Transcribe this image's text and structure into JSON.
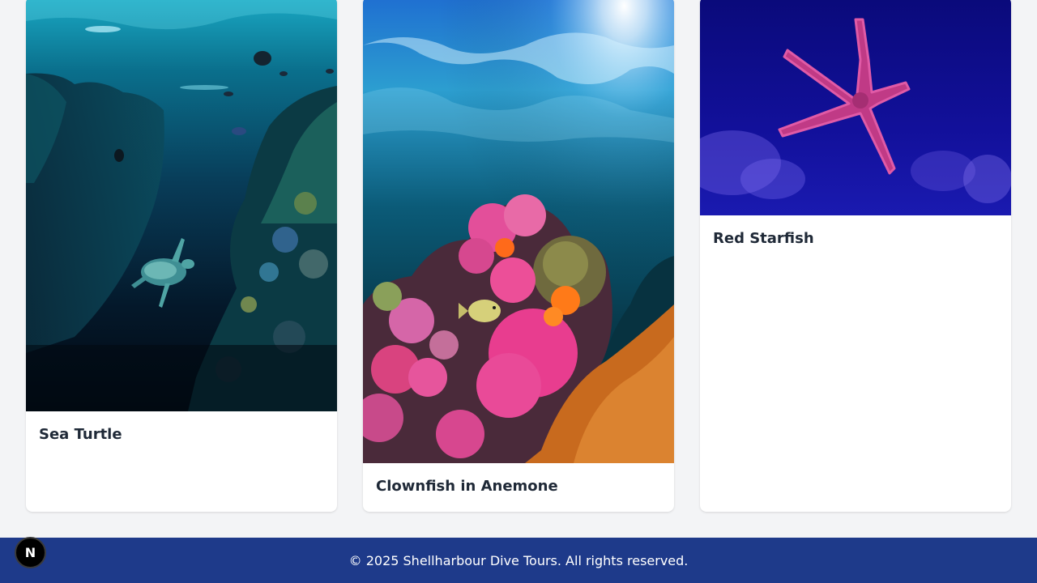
{
  "cards": [
    {
      "title": "Sea Turtle",
      "image": "sea-turtle-reef-photo"
    },
    {
      "title": "Clownfish in Anemone",
      "image": "coral-reef-sunrays-photo"
    },
    {
      "title": "Red Starfish",
      "image": "red-starfish-blue-photo"
    }
  ],
  "footer": {
    "text": "© 2025 Shellharbour Dive Tours. All rights reserved."
  },
  "dev_badge": {
    "letter": "N"
  },
  "colors": {
    "footer_bg": "#1e3a8a",
    "page_bg": "#f3f4f6",
    "title_text": "#1f2937"
  }
}
